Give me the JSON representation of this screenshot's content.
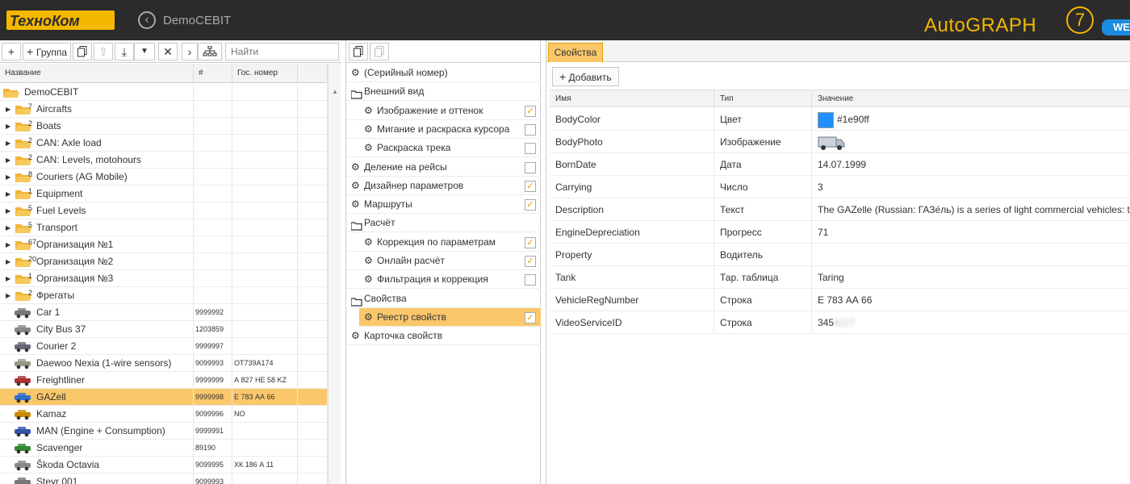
{
  "header": {
    "logo_text": "ТехноКом",
    "app_title": "DemoCEBIT",
    "brand_text": "AutoGRAPH",
    "brand_version": "7",
    "brand_badge": "WE"
  },
  "toolbar": {
    "add_group_label": "Группа",
    "search_placeholder": "Найти"
  },
  "grid": {
    "columns": [
      "Название",
      "#",
      "Гос. номер"
    ],
    "root": "DemoCEBIT",
    "groups": [
      {
        "name": "Aircrafts",
        "count": "7"
      },
      {
        "name": "Boats",
        "count": "2"
      },
      {
        "name": "CAN: Axle load",
        "count": "2"
      },
      {
        "name": "CAN: Levels, motohours",
        "count": "2"
      },
      {
        "name": "Couriers (AG Mobile)",
        "count": "8"
      },
      {
        "name": "Equipment",
        "count": "1"
      },
      {
        "name": "Fuel Levels",
        "count": "5"
      },
      {
        "name": "Transport",
        "count": "5"
      },
      {
        "name": "Организация №1",
        "count": "67"
      },
      {
        "name": "Организация №2",
        "count": "20"
      },
      {
        "name": "Организация №3",
        "count": "1"
      },
      {
        "name": "Фрегаты",
        "count": "2"
      }
    ],
    "vehicles": [
      {
        "name": "Car 1",
        "num": "9999992",
        "plate": "",
        "color": "#777"
      },
      {
        "name": "City Bus 37",
        "num": "1203859",
        "plate": "",
        "color": "#888"
      },
      {
        "name": "Courier 2",
        "num": "9999997",
        "plate": "",
        "color": "#667"
      },
      {
        "name": "Daewoo Nexia (1-wire sensors)",
        "num": "9099993",
        "plate": "OT739A174",
        "color": "#998"
      },
      {
        "name": "Freightliner",
        "num": "9999999",
        "plate": "А 827 НЕ 58 KZ",
        "color": "#a33"
      },
      {
        "name": "GAZell",
        "num": "9999998",
        "plate": "Е 783 АА 66",
        "color": "#2f6fcf",
        "selected": true
      },
      {
        "name": "Kamaz",
        "num": "9099996",
        "plate": "NO",
        "color": "#c80"
      },
      {
        "name": "MAN (Engine + Consumption)",
        "num": "9999991",
        "plate": "",
        "color": "#35a"
      },
      {
        "name": "Scavenger",
        "num": "89190",
        "plate": "",
        "color": "#383"
      },
      {
        "name": "Škoda Octavia",
        "num": "9099995",
        "plate": "ХК 186 А 11",
        "color": "#888"
      },
      {
        "name": "Steyr 001",
        "num": "9099993",
        "plate": "",
        "color": "#777"
      }
    ]
  },
  "modules": [
    {
      "label": "(Серийный номер)",
      "type": "gear",
      "indent": 0
    },
    {
      "label": "Внешний вид",
      "type": "folder",
      "indent": 0
    },
    {
      "label": "Изображение и оттенок",
      "type": "gear",
      "indent": 1,
      "checked": true
    },
    {
      "label": "Мигание и раскраска курсора",
      "type": "gear",
      "indent": 1,
      "checked": false
    },
    {
      "label": "Раскраска трека",
      "type": "gear",
      "indent": 1,
      "checked": false
    },
    {
      "label": "Деление на рейсы",
      "type": "gear",
      "indent": 0,
      "checked": false
    },
    {
      "label": "Дизайнер параметров",
      "type": "gear",
      "indent": 0,
      "checked": true
    },
    {
      "label": "Маршруты",
      "type": "gear",
      "indent": 0,
      "checked": true
    },
    {
      "label": "Расчёт",
      "type": "folder",
      "indent": 0
    },
    {
      "label": "Коррекция по параметрам",
      "type": "gear",
      "indent": 1,
      "checked": true
    },
    {
      "label": "Онлайн расчёт",
      "type": "gear",
      "indent": 1,
      "checked": true
    },
    {
      "label": "Фильтрация и коррекция",
      "type": "gear",
      "indent": 1,
      "checked": false
    },
    {
      "label": "Свойства",
      "type": "folder",
      "indent": 0
    },
    {
      "label": "Реестр свойств",
      "type": "gear",
      "indent": 1,
      "checked": true,
      "selected": true
    },
    {
      "label": "Карточка свойств",
      "type": "gear",
      "indent": 0
    }
  ],
  "properties": {
    "tab_label": "Свойства",
    "add_label": "Добавить",
    "columns": [
      "Имя",
      "Тип",
      "Значение"
    ],
    "rows": [
      {
        "name": "BodyColor",
        "type": "Цвет",
        "value": "#1e90ff",
        "swatch": "#1e90ff"
      },
      {
        "name": "BodyPhoto",
        "type": "Изображение",
        "value": "",
        "photo": true
      },
      {
        "name": "BornDate",
        "type": "Дата",
        "value": "14.07.1999"
      },
      {
        "name": "Carrying",
        "type": "Число",
        "value": "3"
      },
      {
        "name": "Description",
        "type": "Текст",
        "value": "The GAZelle (Russian: ГАЗе́ль) is a series of light commercial vehicles: trucks, vans"
      },
      {
        "name": "EngineDepreciation",
        "type": "Прогресс",
        "value": "71"
      },
      {
        "name": "Property",
        "type": "Водитель",
        "value": ""
      },
      {
        "name": "Tank",
        "type": "Тар. таблица",
        "value": "Taring"
      },
      {
        "name": "VehicleRegNumber",
        "type": "Строка",
        "value": "Е 783 АА 66"
      },
      {
        "name": "VideoServiceID",
        "type": "Строка",
        "value": "345",
        "blurred": "6117"
      }
    ]
  },
  "colors": {
    "accent": "#fbc76b",
    "topbar": "#2b2b2b",
    "brand": "#f5b800",
    "folder": "#f0b43a"
  }
}
